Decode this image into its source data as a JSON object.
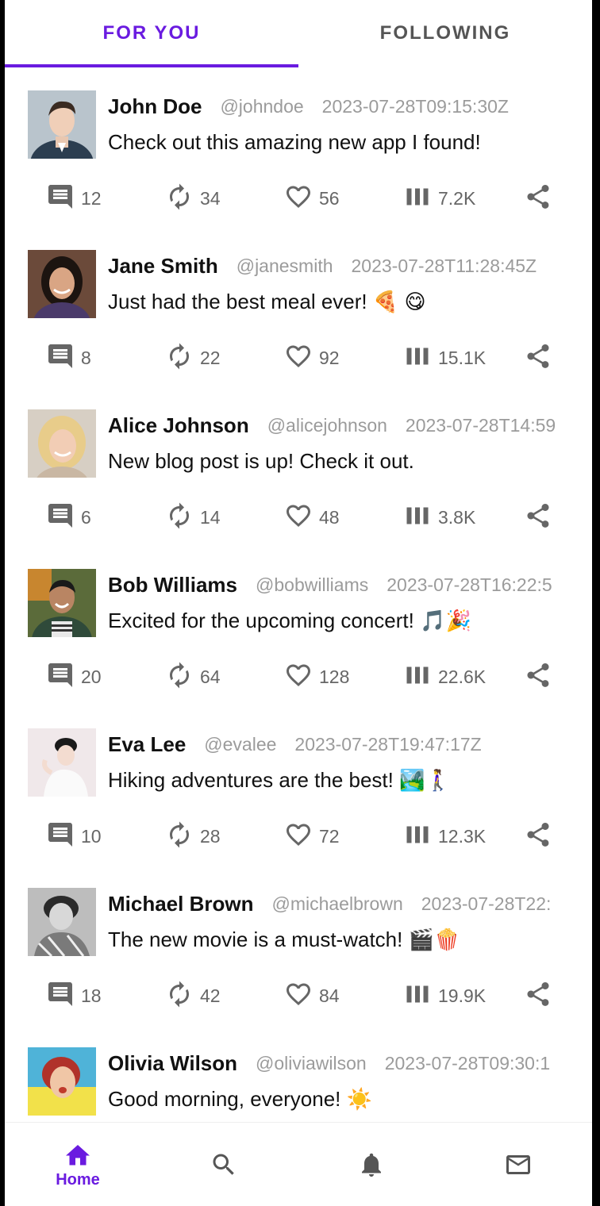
{
  "tabs": [
    {
      "label": "FOR YOU",
      "active": true
    },
    {
      "label": "FOLLOWING",
      "active": false
    }
  ],
  "accent_color": "#6a1be0",
  "posts": [
    {
      "name": "John Doe",
      "handle": "@johndoe",
      "timestamp": "2023-07-28T09:15:30Z",
      "text": "Check out this amazing new app I found!",
      "comments": "12",
      "reposts": "34",
      "likes": "56",
      "views": "7.2K"
    },
    {
      "name": "Jane Smith",
      "handle": "@janesmith",
      "timestamp": "2023-07-28T11:28:45Z",
      "text": "Just had the best meal ever! 🍕 😋",
      "comments": "8",
      "reposts": "22",
      "likes": "92",
      "views": "15.1K"
    },
    {
      "name": "Alice Johnson",
      "handle": "@alicejohnson",
      "timestamp": "2023-07-28T14:59",
      "text": "New blog post is up! Check it out.",
      "comments": "6",
      "reposts": "14",
      "likes": "48",
      "views": "3.8K"
    },
    {
      "name": "Bob Williams",
      "handle": "@bobwilliams",
      "timestamp": "2023-07-28T16:22:5",
      "text": "Excited for the upcoming concert! 🎵🎉",
      "comments": "20",
      "reposts": "64",
      "likes": "128",
      "views": "22.6K"
    },
    {
      "name": "Eva Lee",
      "handle": "@evalee",
      "timestamp": "2023-07-28T19:47:17Z",
      "text": "Hiking adventures are the best! 🏞️🚶‍♀️",
      "comments": "10",
      "reposts": "28",
      "likes": "72",
      "views": "12.3K"
    },
    {
      "name": "Michael Brown",
      "handle": "@michaelbrown",
      "timestamp": "2023-07-28T22:",
      "text": "The new movie is a must-watch! 🎬🍿",
      "comments": "18",
      "reposts": "42",
      "likes": "84",
      "views": "19.9K"
    },
    {
      "name": "Olivia Wilson",
      "handle": "@oliviawilson",
      "timestamp": "2023-07-28T09:30:1",
      "text": "Good morning, everyone! ☀️",
      "comments": "",
      "reposts": "",
      "likes": "",
      "views": ""
    }
  ],
  "nav": {
    "home_label": "Home",
    "icons": [
      "home-icon",
      "search-icon",
      "bell-icon",
      "mail-icon"
    ]
  }
}
